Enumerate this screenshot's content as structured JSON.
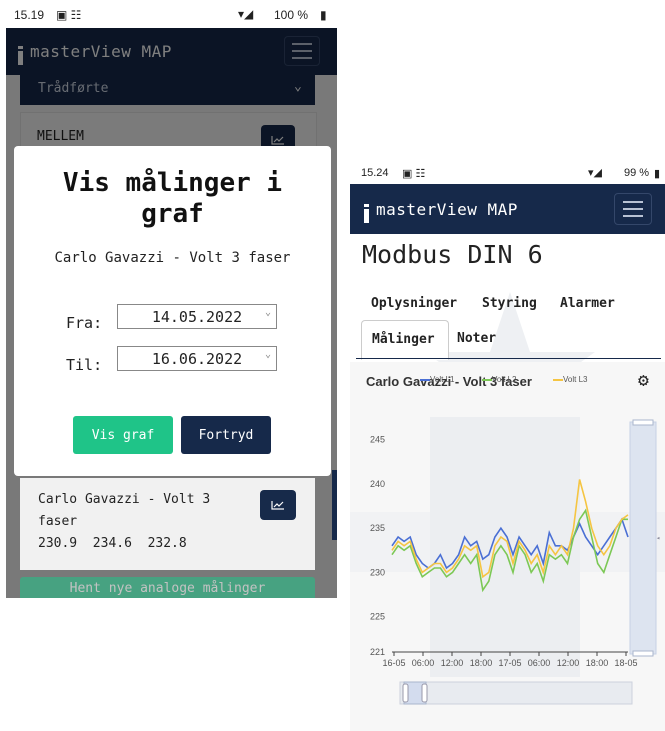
{
  "left_phone": {
    "status": {
      "time": "15.19",
      "battery": "100 %"
    },
    "brand": "masterView MAP",
    "dropdown_label": "Trådførte",
    "card_top_label": "MELLEM",
    "modal": {
      "title": "Vis målinger i graf",
      "subtitle": "Carlo Gavazzi - Volt 3 faser",
      "from_label": "Fra:",
      "from_value": "14.05.2022",
      "to_label": "Til:",
      "to_value": "16.06.2022",
      "show_button": "Vis graf",
      "cancel_button": "Fortryd"
    },
    "card": {
      "name_line1": "Carlo Gavazzi - Volt 3",
      "name_line2": "faser",
      "values": "230.9  234.6  232.8"
    },
    "fetch_button": "Hent nye analoge målinger"
  },
  "right_phone": {
    "status": {
      "time": "15.24",
      "battery": "99 %"
    },
    "brand": "masterView MAP",
    "page_title": "Modbus DIN 6",
    "tabs": [
      "Oplysninger",
      "Styring",
      "Alarmer",
      "Målinger",
      "Noter"
    ],
    "chart_title": "Carlo Gavazzi - Volt 3 faser",
    "legend": [
      "Volt L1",
      "Volt L2",
      "Volt L3"
    ],
    "colors": {
      "l1": "#4a6fd4",
      "l2": "#7cc855",
      "l3": "#f5c542",
      "navy": "#16294a",
      "green": "#1fc488"
    }
  },
  "chart_data": {
    "type": "line",
    "title": "Carlo Gavazzi - Volt 3 faser",
    "ylim": [
      221,
      247
    ],
    "yticks": [
      221,
      225,
      230,
      235,
      240,
      245
    ],
    "xtick_labels": [
      "16-05",
      "06:00",
      "12:00",
      "18:00",
      "17-05",
      "06:00",
      "12:00",
      "18:00",
      "18-05"
    ],
    "series": [
      {
        "name": "Volt L1",
        "values": [
          233,
          234,
          233.5,
          234,
          232,
          231,
          230.5,
          231,
          232,
          230.5,
          231,
          232,
          234,
          233,
          233.5,
          231.5,
          232,
          234,
          235,
          234,
          232,
          234,
          233,
          232,
          233,
          231,
          234.5,
          233,
          233,
          232.5,
          234,
          235.5,
          234,
          233,
          232,
          233,
          234,
          235,
          236,
          234
        ]
      },
      {
        "name": "Volt L2",
        "values": [
          232,
          233,
          232.5,
          233,
          231,
          229.5,
          230,
          230.5,
          230.5,
          229.5,
          230,
          231,
          232,
          231,
          232,
          228,
          229,
          232,
          233,
          232,
          230,
          233,
          232,
          230,
          231,
          229,
          232,
          231.5,
          232,
          231,
          234,
          236,
          237,
          234,
          231,
          230,
          232,
          234,
          236,
          236
        ]
      },
      {
        "name": "Volt L3",
        "values": [
          232.5,
          233.5,
          233,
          233.5,
          231.5,
          230,
          230.5,
          231,
          231,
          230,
          230.5,
          231.5,
          233,
          232.5,
          233,
          229.5,
          230,
          233,
          234,
          233.5,
          231,
          233.5,
          232.5,
          231,
          232,
          230,
          233,
          232,
          233,
          232,
          235,
          240.5,
          238,
          235,
          233,
          232,
          233,
          235,
          236,
          236.5
        ]
      }
    ]
  }
}
